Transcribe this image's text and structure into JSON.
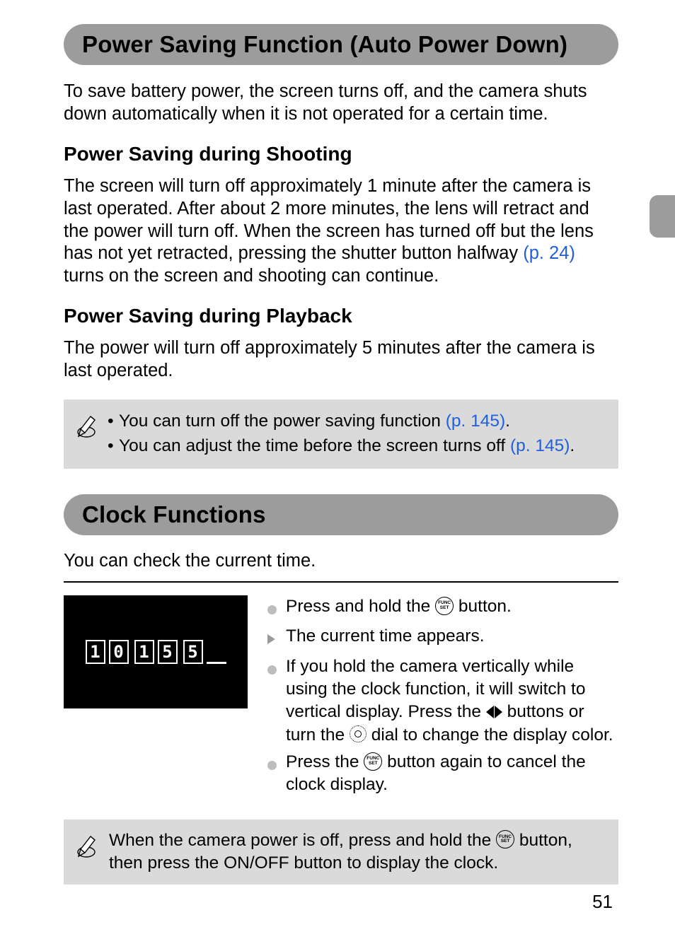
{
  "page_number": "51",
  "section1": {
    "title": "Power Saving Function (Auto Power Down)",
    "intro": "To save battery power, the screen turns off, and the camera shuts down automatically when it is not operated for a certain time.",
    "sub1_title": "Power Saving during Shooting",
    "sub1_body_pre": "The screen will turn off approximately 1 minute after the camera is last operated. After about 2 more minutes, the lens will retract and the power will turn off. When the screen has turned off but the lens has not yet retracted, pressing the shutter button halfway ",
    "sub1_link": "(p. 24)",
    "sub1_body_post": " turns on the screen and shooting can continue.",
    "sub2_title": "Power Saving during Playback",
    "sub2_body": "The power will turn off approximately 5 minutes after the camera is last operated.",
    "tips": [
      {
        "pre": "You can turn off the power saving function ",
        "link": "(p. 145)",
        "post": "."
      },
      {
        "pre": "You can adjust the time before the screen turns off ",
        "link": "(p. 145)",
        "post": "."
      }
    ]
  },
  "section2": {
    "title": "Clock Functions",
    "intro": "You can check the current time.",
    "clock_digits": [
      "1",
      "0",
      "1",
      "5",
      "5"
    ],
    "steps": {
      "s1_pre": "Press and hold the ",
      "s1_post": " button.",
      "s2": "The current time appears.",
      "s3_pre": "If you hold the camera vertically while using the clock function, it will switch to vertical display. Press the ",
      "s3_mid": " buttons or turn the ",
      "s3_post": " dial to change the display color.",
      "s4_pre": "Press the ",
      "s4_post": " button again to cancel the clock display."
    },
    "tip_pre": "When the camera power is off, press and hold the ",
    "tip_post": " button, then press the ON/OFF button to display the clock."
  },
  "icons": {
    "func_top": "FUNC",
    "func_bot": "SET"
  }
}
